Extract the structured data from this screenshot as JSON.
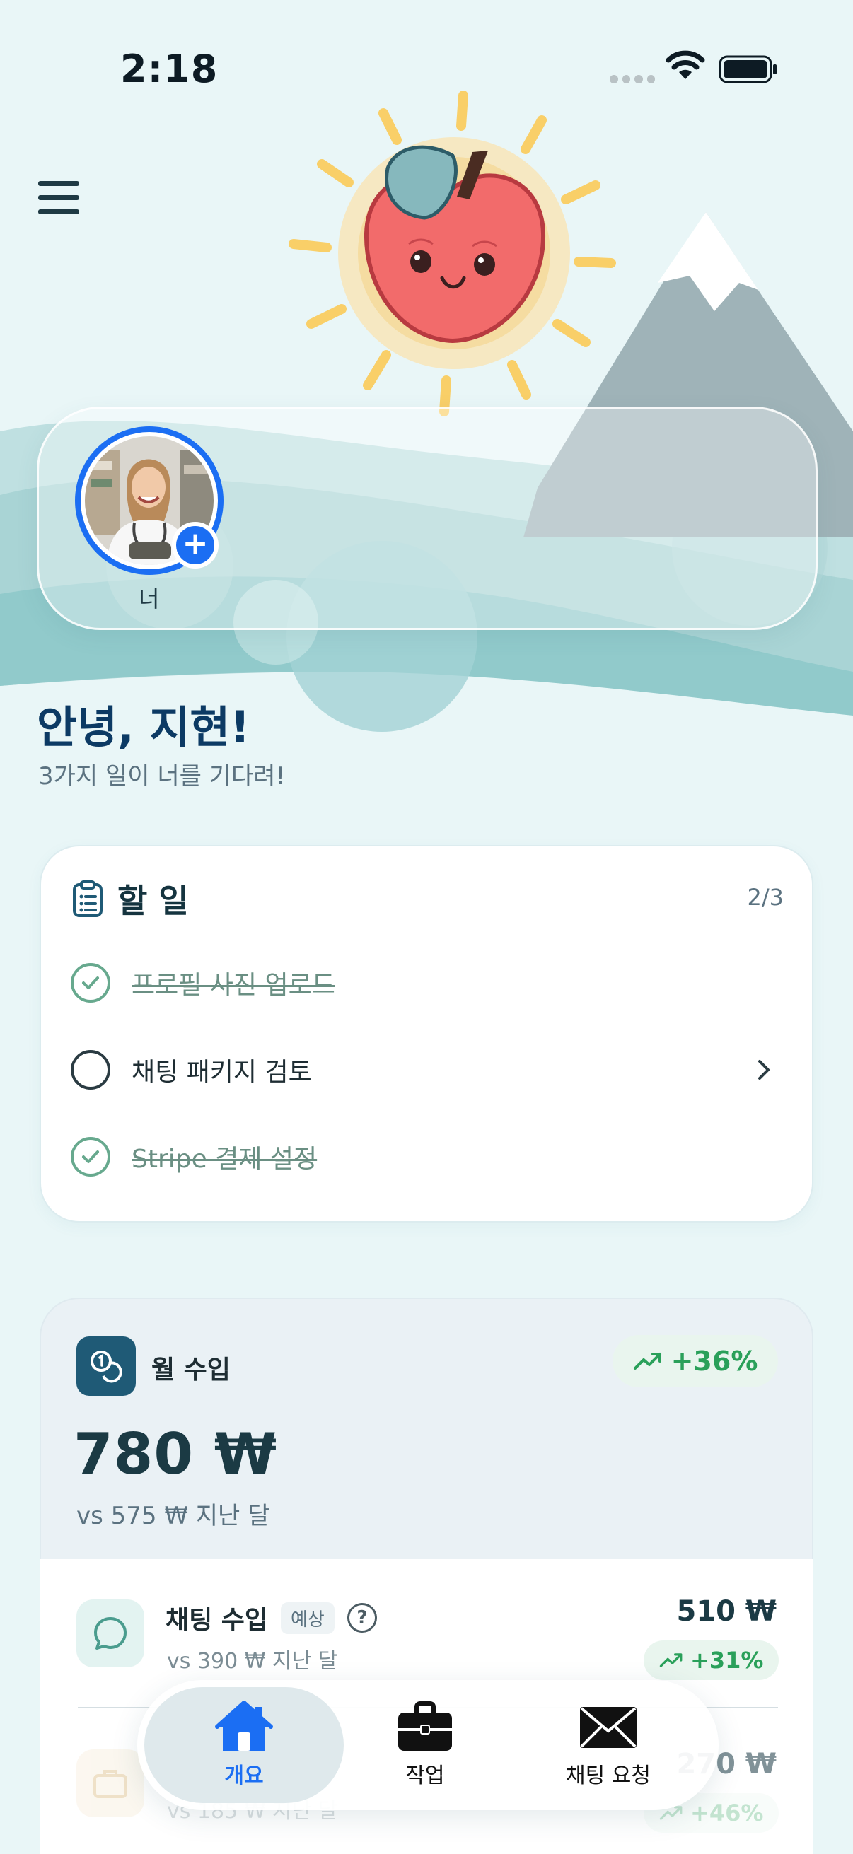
{
  "status": {
    "time": "2:18"
  },
  "stories": {
    "self_label": "너"
  },
  "greeting": {
    "title": "안녕, 지현!",
    "subtitle": "3가지 일이 너를 기다려!"
  },
  "tasks": {
    "title": "할 일",
    "count": "2/3",
    "items": [
      {
        "label": "프로필 사진 업로드",
        "done": true
      },
      {
        "label": "채팅 패키지 검토",
        "done": false
      },
      {
        "label": "Stripe 결제 설정",
        "done": true
      }
    ]
  },
  "income": {
    "label": "월 수입",
    "change": "+36%",
    "amount": "780 ₩",
    "previous": "vs 575 ₩ 지난 달",
    "rows": [
      {
        "title": "채팅 수입",
        "tag": "예상",
        "help": "?",
        "previous": "vs 390 ₩ 지난 달",
        "amount": "510 ₩",
        "change": "+31%"
      },
      {
        "previous": "vs 185 ₩ 지난 달",
        "amount": "270 ₩",
        "change": "+46%"
      }
    ]
  },
  "nav": {
    "items": [
      {
        "label": "개요",
        "icon": "home-icon",
        "active": true
      },
      {
        "label": "작업",
        "icon": "briefcase-icon",
        "active": false
      },
      {
        "label": "채팅 요청",
        "icon": "mail-icon",
        "active": false
      }
    ]
  },
  "colors": {
    "accent": "#1b6ef3",
    "positive": "#2aa05a",
    "heading": "#0c3a64"
  }
}
